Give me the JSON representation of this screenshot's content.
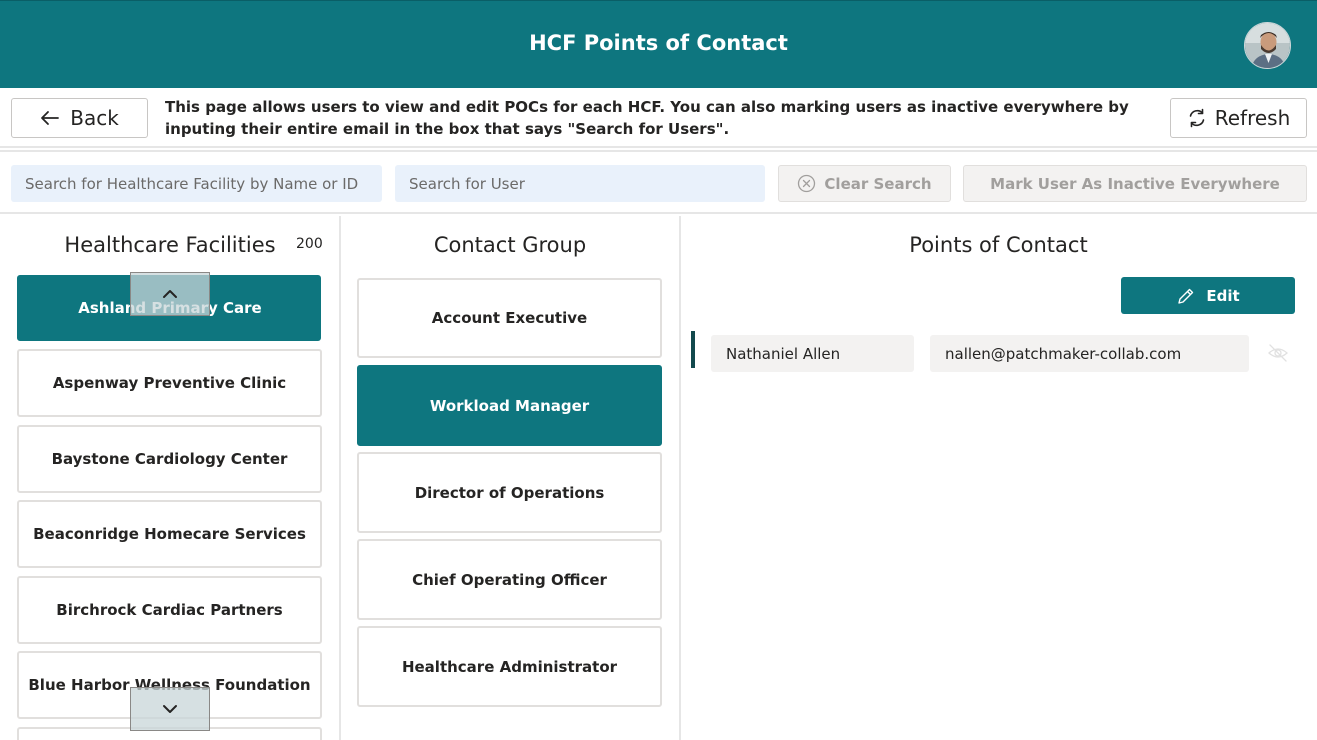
{
  "header": {
    "title": "HCF Points of Contact",
    "avatar_icon": "user-avatar"
  },
  "toolbar": {
    "back_label": "Back",
    "refresh_label": "Refresh",
    "info_text": "This page allows users to view and edit POCs for each HCF. You can also marking users as inactive everywhere by inputing their entire email in the box that says \"Search for Users\"."
  },
  "search": {
    "facility_placeholder": "Search for Healthcare Facility by Name or ID",
    "user_placeholder": "Search for User",
    "clear_label": "Clear Search",
    "mark_inactive_label": "Mark User As Inactive Everywhere"
  },
  "facilities": {
    "title": "Healthcare Facilities",
    "count": "200",
    "items": [
      {
        "label": "Ashland Primary Care",
        "selected": true
      },
      {
        "label": "Aspenway Preventive Clinic",
        "selected": false
      },
      {
        "label": "Baystone Cardiology Center",
        "selected": false
      },
      {
        "label": "Beaconridge Homecare Services",
        "selected": false
      },
      {
        "label": "Birchrock Cardiac Partners",
        "selected": false
      },
      {
        "label": "Blue Harbor Wellness Foundation",
        "selected": false
      }
    ]
  },
  "contact_groups": {
    "title": "Contact Group",
    "items": [
      {
        "label": "Account Executive",
        "selected": false
      },
      {
        "label": "Workload Manager",
        "selected": true
      },
      {
        "label": "Director of Operations",
        "selected": false
      },
      {
        "label": "Chief Operating Officer",
        "selected": false
      },
      {
        "label": "Healthcare Administrator",
        "selected": false
      }
    ]
  },
  "points_of_contact": {
    "title": "Points of Contact",
    "edit_label": "Edit",
    "contacts": [
      {
        "name": "Nathaniel Allen",
        "email": "nallen@patchmaker-collab.com"
      }
    ]
  },
  "colors": {
    "brand": "#0e767f",
    "brand_dark": "#12494d",
    "input_bg": "#e9f1fb",
    "disabled_bg": "#f3f2f1"
  }
}
